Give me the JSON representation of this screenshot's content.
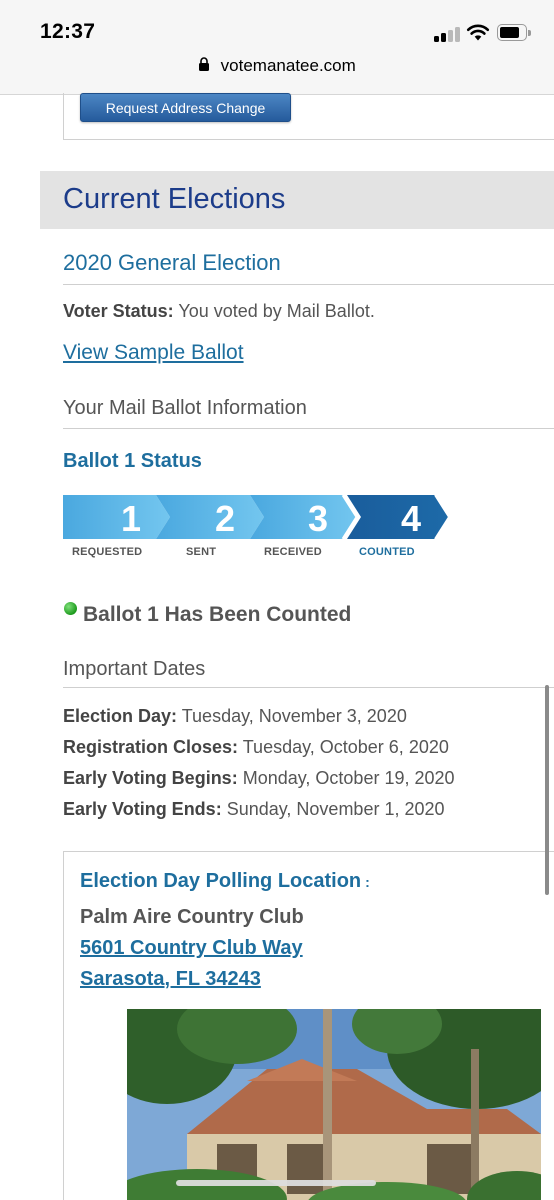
{
  "status_bar": {
    "time": "12:37"
  },
  "browser": {
    "url": "votemanatee.com"
  },
  "address": {
    "request_change_label": "Request Address Change"
  },
  "current_elections": {
    "heading": "Current Elections",
    "election_name": "2020 General Election",
    "voter_status_label": "Voter Status:",
    "voter_status_value": "You voted by Mail Ballot.",
    "sample_ballot_link": "View Sample Ballot",
    "mail_ballot_heading": "Your Mail Ballot Information",
    "ballot_status_heading": "Ballot 1 Status",
    "steps": [
      {
        "number": "1",
        "label": "REQUESTED"
      },
      {
        "number": "2",
        "label": "SENT"
      },
      {
        "number": "3",
        "label": "RECEIVED"
      },
      {
        "number": "4",
        "label": "COUNTED"
      }
    ],
    "current_step": 4,
    "ballot_result": "Ballot 1 Has Been Counted",
    "important_dates_heading": "Important Dates",
    "dates": [
      {
        "label": "Election Day:",
        "value": "Tuesday, November 3, 2020"
      },
      {
        "label": "Registration Closes:",
        "value": "Tuesday, October 6, 2020"
      },
      {
        "label": "Early Voting Begins:",
        "value": "Monday, October 19, 2020"
      },
      {
        "label": "Early Voting Ends:",
        "value": "Sunday, November 1, 2020"
      }
    ],
    "polling": {
      "title": "Election Day Polling Location",
      "title_suffix": ":",
      "place_name": "Palm Aire Country Club",
      "address_line1": "5601 Country Club Way",
      "address_line2": "Sarasota, FL 34243"
    }
  },
  "colors": {
    "heading_navy": "#1c3c8a",
    "link_blue": "#1e6e9e",
    "step_light": "#5ab8e8",
    "step_dark": "#1a5d9c",
    "counted_green": "#1d9a1d"
  }
}
